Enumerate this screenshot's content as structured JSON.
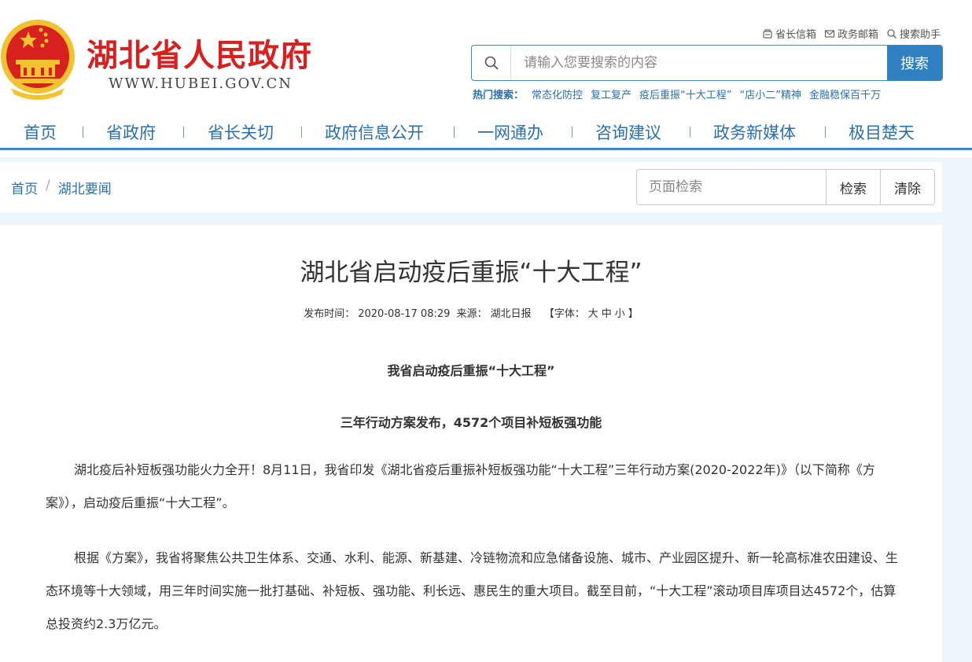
{
  "header": {
    "site_title": "湖北省人民政府",
    "site_url": "WWW.HUBEI.GOV.CN",
    "top_links": [
      {
        "label": "省长信箱",
        "icon": "mailbox-icon"
      },
      {
        "label": "政务邮箱",
        "icon": "envelope-icon"
      },
      {
        "label": "搜索助手",
        "icon": "search-icon"
      }
    ],
    "search": {
      "placeholder": "请输入您要搜索的内容",
      "button": "搜索"
    },
    "hot_search": {
      "label": "热门搜索：",
      "items": [
        "常态化防控",
        "复工复产",
        "疫后重振“十大工程”",
        "“店小二”精神",
        "金融稳保百千万"
      ]
    }
  },
  "nav": {
    "items": [
      "首页",
      "省政府",
      "省长关切",
      "政府信息公开",
      "一网通办",
      "咨询建议",
      "政务新媒体",
      "极目楚天"
    ]
  },
  "breadcrumb": {
    "items": [
      "首页",
      "湖北要闻"
    ],
    "separator": "/"
  },
  "page_search": {
    "placeholder": "页面检索",
    "search_button": "检索",
    "clear_button": "清除"
  },
  "article": {
    "title": "湖北省启动疫后重振“十大工程”",
    "meta": {
      "publish_label": "发布时间：",
      "publish_time": "2020-08-17 08:29",
      "source_label": "来源：",
      "source": "湖北日报",
      "font_open": "【字体：",
      "font_large": "大",
      "font_medium": "中",
      "font_small": "小",
      "font_close": "】"
    },
    "subtitle_1": "我省启动疫后重振“十大工程”",
    "subtitle_2": "三年行动方案发布，4572个项目补短板强功能",
    "paragraph_1": "湖北疫后补短板强功能火力全开！8月11日，我省印发《湖北省疫后重振补短板强功能“十大工程”三年行动方案(2020-2022年)》（以下简称《方案》），启动疫后重振“十大工程”。",
    "paragraph_2": "根据《方案》，我省将聚焦公共卫生体系、交通、水利、能源、新基建、冷链物流和应急储备设施、城市、产业园区提升、新一轮高标准农田建设、生态环境等十大领域，用三年时间实施一批打基础、补短板、强功能、利长远、惠民生的重大项目。截至目前，“十大工程”滚动项目库项目达4572个，估算总投资约2.3万亿元。"
  },
  "colors": {
    "title_red": "#d8201f",
    "link_blue": "#2a6fb0",
    "button_blue": "#2f7fc1",
    "emblem_gold": "#f2c230"
  }
}
